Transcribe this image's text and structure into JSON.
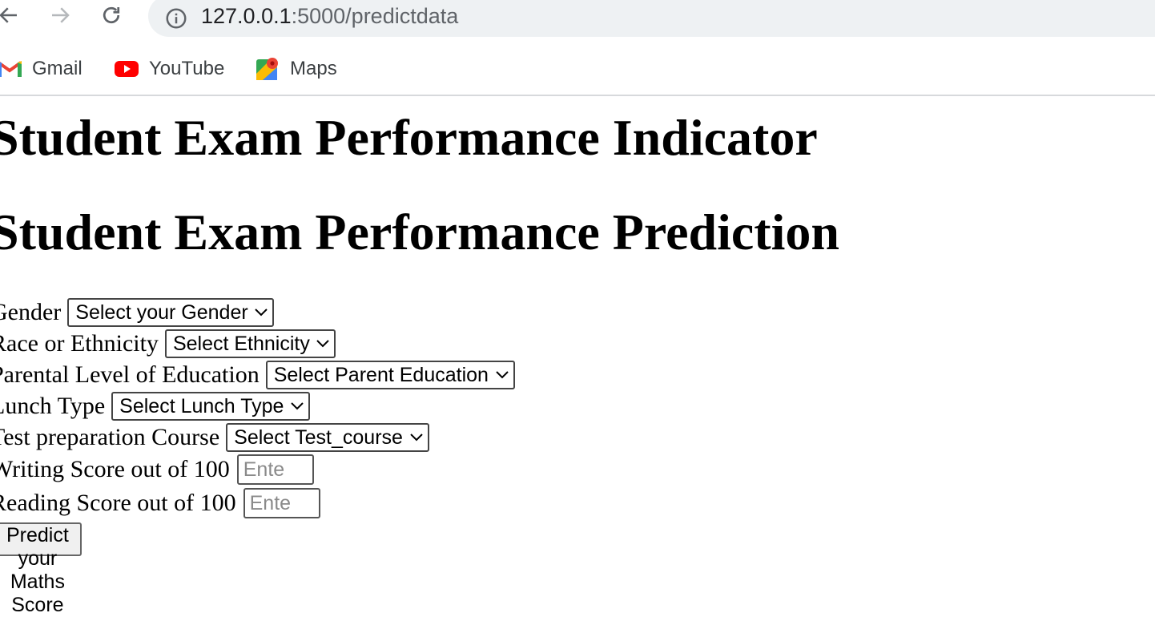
{
  "browser": {
    "url_host": "127.0.0.1",
    "url_rest": ":5000/predictdata",
    "bookmarks": [
      {
        "label": "Gmail",
        "icon": "gmail-icon"
      },
      {
        "label": "YouTube",
        "icon": "youtube-icon"
      },
      {
        "label": "Maps",
        "icon": "maps-icon"
      }
    ]
  },
  "page": {
    "title": "Student Exam Performance Indicator",
    "subtitle": "Student Exam Performance Prediction"
  },
  "form": {
    "gender": {
      "label": "Gender",
      "selected": "Select your Gender"
    },
    "ethnicity": {
      "label": "Race or Ethnicity",
      "selected": "Select Ethnicity"
    },
    "parental_education": {
      "label": "Parental Level of Education",
      "selected": "Select Parent Education"
    },
    "lunch": {
      "label": "Lunch Type",
      "selected": "Select Lunch Type"
    },
    "test_prep": {
      "label": "Test preparation Course",
      "selected": "Select Test_course"
    },
    "writing_score": {
      "label": "Writing Score out of 100",
      "placeholder": "Ente",
      "value": ""
    },
    "reading_score": {
      "label": "Reading Score out of 100",
      "placeholder": "Ente",
      "value": ""
    },
    "submit_label": "Predict your Maths Score"
  }
}
